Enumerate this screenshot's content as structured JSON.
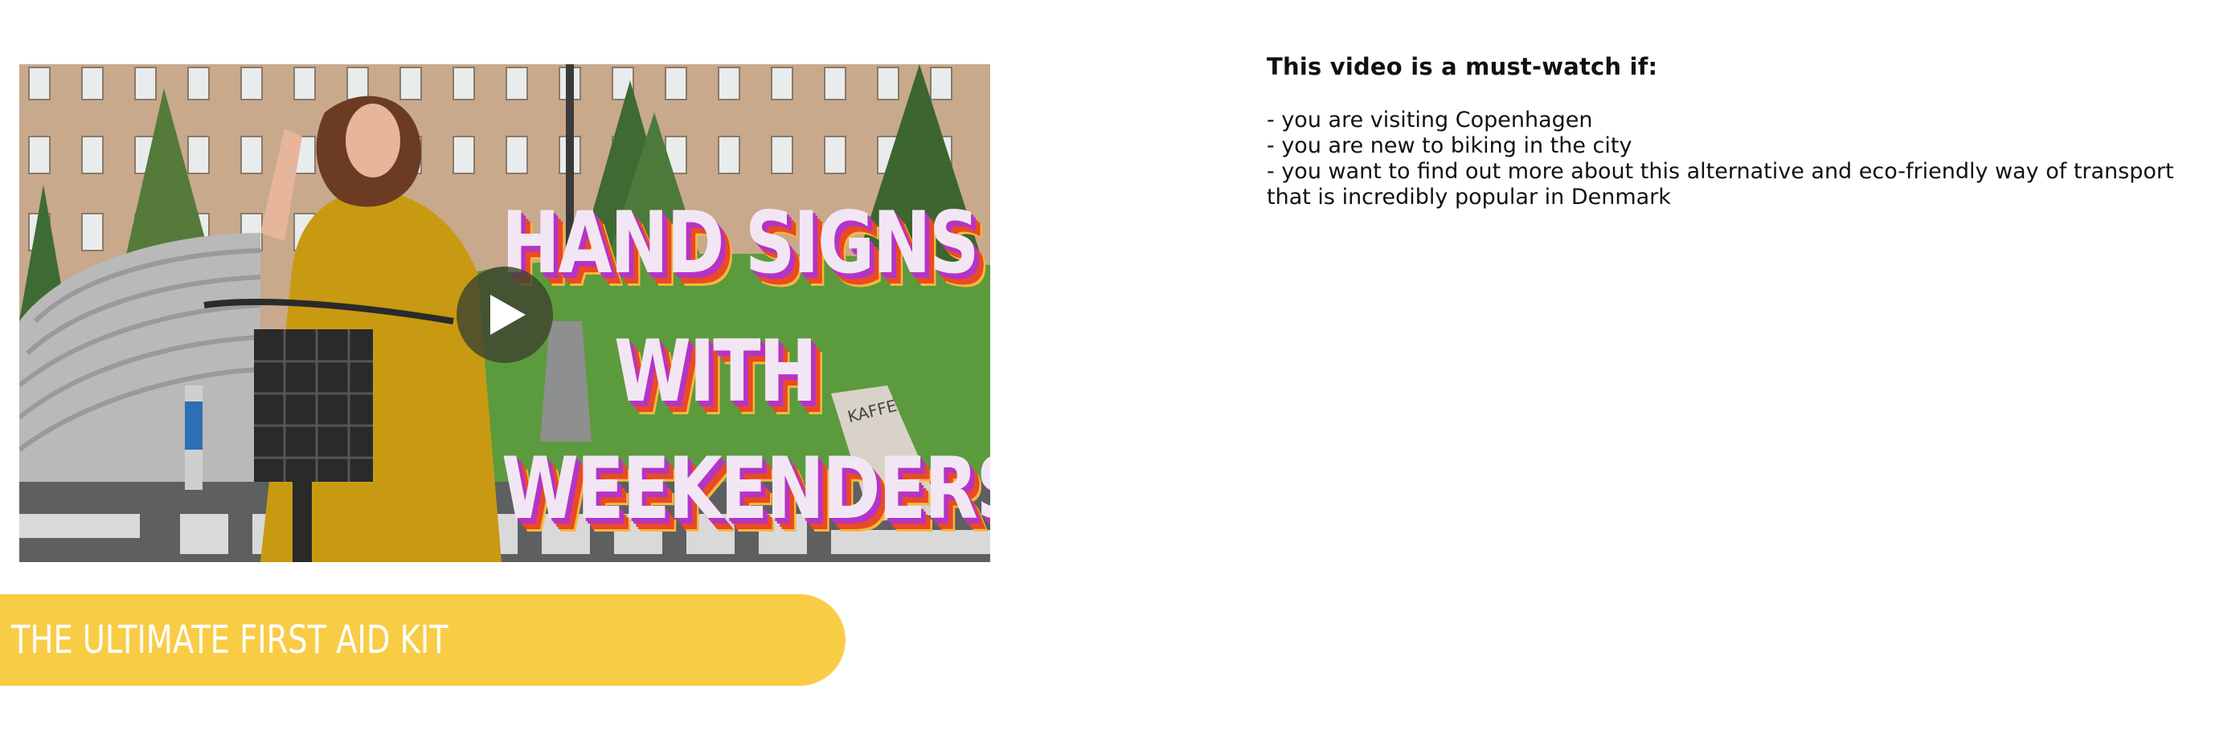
{
  "video": {
    "title_lines": [
      "HAND SIGNS",
      "WITH",
      "WEEKENDERS"
    ],
    "sign_text": "KAFFE",
    "play_icon": "play-icon",
    "colors": {
      "title_fill": "#f3e6f4",
      "title_shadow_1": "#b534c5",
      "title_shadow_2": "#ea4a24",
      "title_shadow_3": "#f3b93a"
    }
  },
  "banner": {
    "label": "THE ULTIMATE FIRST AID KIT",
    "color": "#f9cc46"
  },
  "description": {
    "heading": "This video is a must-watch if:",
    "items": [
      "- you are visiting Copenhagen",
      "- you are new to biking in the city",
      "- you want to find out more about this alternative and eco-friendly way of transport that is incredibly popular in Denmark"
    ]
  }
}
